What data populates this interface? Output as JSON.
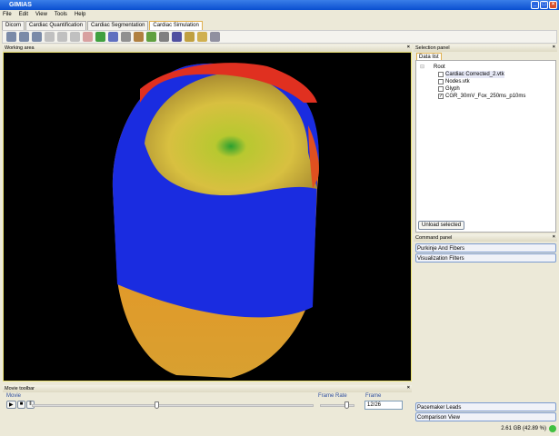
{
  "window": {
    "title": "GIMIAS"
  },
  "menu": [
    "File",
    "Edit",
    "View",
    "Tools",
    "Help"
  ],
  "tabs": [
    {
      "label": "Dicom"
    },
    {
      "label": "Cardiac Quantification"
    },
    {
      "label": "Cardiac Segmentation"
    },
    {
      "label": "Cardiac Simulation",
      "active": true
    }
  ],
  "toolbar_icons": [
    "layout-1-icon",
    "layout-2-icon",
    "layout-3-icon",
    "view-x-icon",
    "view-y-icon",
    "view-z-icon",
    "view-3d-icon",
    "recycle-icon",
    "transform-icon",
    "line-icon",
    "clipboard-icon",
    "eye-icon",
    "camera-icon",
    "sphere-icon",
    "document-icon",
    "ruler-icon",
    "lasso-icon"
  ],
  "working_area": {
    "title": "Working area"
  },
  "selection_panel": {
    "title": "Selection panel",
    "tab": "Data list",
    "root": "Root",
    "items": [
      {
        "label": "Cardiac Corrected_2.vtk",
        "checked": false
      },
      {
        "label": "Nodes.vtk",
        "checked": false
      },
      {
        "label": "Glyph",
        "checked": false
      },
      {
        "label": "CGR_30mV_Fox_250ms_p10ms",
        "checked": true
      }
    ],
    "unload_button": "Unload selected"
  },
  "command_panel": {
    "title": "Command panel",
    "items": [
      "Purkinje And Fibers",
      "Visualization Filters"
    ],
    "bottom_items": [
      "Pacemaker Leads",
      "Comparison View"
    ]
  },
  "movie_toolbar": {
    "title": "Movie toolbar",
    "movie_label": "Movie",
    "frame_rate_label": "Frame Rate",
    "frame_label": "Frame",
    "frame_value": "12/26",
    "movie_progress": 0.44,
    "frame_rate_level": 0.8
  },
  "status": {
    "memory": "2.61 GB (42.89 %)"
  }
}
